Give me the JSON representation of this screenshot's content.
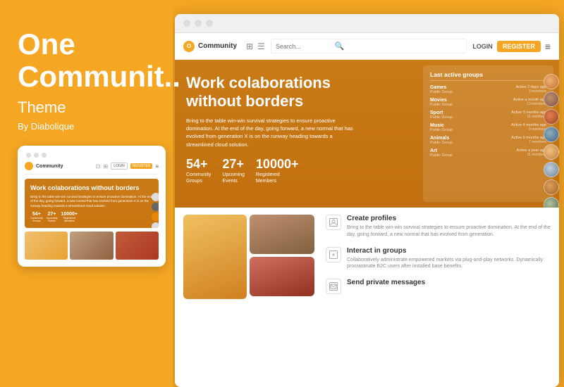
{
  "background_color": "#F5A623",
  "left": {
    "brand_line1": "One",
    "brand_line2": "Communit..",
    "brand_sub": "Theme",
    "brand_by": "By Diabolique"
  },
  "mobile": {
    "nav_brand": "Community",
    "nav_login": "LOGIN",
    "nav_register": "REGISTER",
    "hero_title": "Work colaborations without borders",
    "hero_text": "Bring to the table win-win survival strategies to ensure proactive domination. At the end of the day, going forward, a new normal that has evolved from generation X is on the runway heading towards a streamlined cloud solution.",
    "stats": [
      {
        "num": "54+",
        "label1": "Community",
        "label2": "Groups"
      },
      {
        "num": "27+",
        "label1": "Upcoming",
        "label2": "Events"
      },
      {
        "num": "10000+",
        "label1": "Registered",
        "label2": "Members"
      }
    ]
  },
  "browser": {
    "nav_search_placeholder": "Search...",
    "nav_login": "LOGIN",
    "nav_register": "REGISTER",
    "nav_brand": "Community",
    "hero": {
      "title_work": "Work",
      "title_rest": " colaborations without borders",
      "description": "Bring to the table win-win survival strategies to ensure proactive domination. At the end of the day, going forward, a new normal that has evolved from generation X is on the runway heading towards a streamlined cloud solution.",
      "stats": [
        {
          "num": "54+",
          "label1": "Community",
          "label2": "Groups"
        },
        {
          "num": "27+",
          "label1": "Upcoming",
          "label2": "Events"
        },
        {
          "num": "10000+",
          "label1": "Registered",
          "label2": "Members"
        }
      ]
    },
    "active_groups": {
      "title": "Last active groups",
      "groups": [
        {
          "name": "Games",
          "type": "Public Group",
          "time": "Active 2 days ago",
          "members": "3 members"
        },
        {
          "name": "Movies",
          "type": "Public Group",
          "time": "Active a month ago",
          "members": "13 members"
        },
        {
          "name": "Sport",
          "type": "Public Group",
          "time": "Active 3 months ago",
          "members": "11 members"
        },
        {
          "name": "Music",
          "type": "Public Group",
          "time": "Active 4 months ago",
          "members": "9 members"
        },
        {
          "name": "Animals",
          "type": "Public Group",
          "time": "Active 6 months ago",
          "members": "7 members"
        },
        {
          "name": "Art",
          "type": "Public Group",
          "time": "Active a year ago",
          "members": "11 members"
        }
      ]
    },
    "features": [
      {
        "icon": "👤",
        "title": "Create profiles",
        "text": "Bring to the table win-win survival strategies to ensure proactive domination. At the end of the day, going forward, a new normal that has evolved from generation."
      },
      {
        "icon": "↕",
        "title": "Interact in groups",
        "text": "Collaboratively administrate empowered markets via plug-and-play networks. Dynamically procrastinate B2C users after installed base benefits."
      },
      {
        "icon": "✉",
        "title": "Send private messages",
        "text": ""
      }
    ]
  }
}
